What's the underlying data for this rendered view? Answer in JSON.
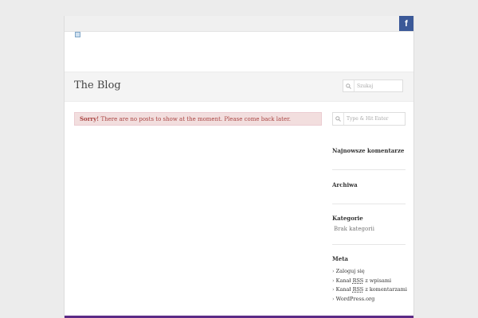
{
  "social": {
    "facebook_label": "f"
  },
  "header": {
    "site_title": "The Blog"
  },
  "search": {
    "top_placeholder": "Szukaj",
    "sidebar_placeholder": "Type & Hit Enter"
  },
  "alert": {
    "strong": "Sorry!",
    "message": " There are no posts to show at the moment. Please come back later."
  },
  "sidebar": {
    "recent_comments_title": "Najnowsze komentarze",
    "archives_title": "Archiwa",
    "categories_title": "Kategorie",
    "categories_empty": "Brak kategorii",
    "meta_title": "Meta",
    "meta_links": {
      "login": "Zaloguj się",
      "entries_rss_pre": "Kanał ",
      "entries_rss_abbr": "RSS",
      "entries_rss_post": " z wpisami",
      "comments_rss_pre": "Kanał ",
      "comments_rss_abbr": "RSS",
      "comments_rss_post": " z komentarzami",
      "wordpress": "WordPress.org"
    }
  },
  "colors": {
    "facebook": "#3b5998",
    "alert_bg": "#f2dede",
    "alert_text": "#a94442",
    "footer_bar": "#5b2a86"
  }
}
